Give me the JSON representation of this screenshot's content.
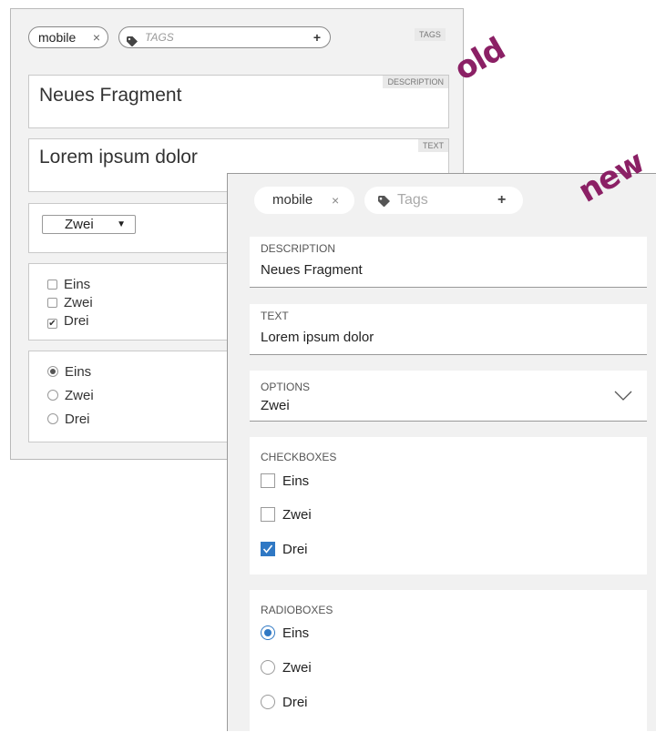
{
  "old": {
    "stamp": "old",
    "tags": {
      "chip": "mobile",
      "remove_glyph": "×",
      "placeholder": "TAGS",
      "add_glyph": "+",
      "section_label": "TAGS"
    },
    "description": {
      "label": "DESCRIPTION",
      "value": "Neues Fragment"
    },
    "text": {
      "label": "TEXT",
      "value": "Lorem ipsum dolor"
    },
    "select": {
      "value": "Zwei",
      "arrow": "▼"
    },
    "checkboxes": [
      {
        "label": "Eins",
        "checked": false
      },
      {
        "label": "Zwei",
        "checked": false
      },
      {
        "label": "Drei",
        "checked": true
      }
    ],
    "radios": [
      {
        "label": "Eins",
        "selected": true
      },
      {
        "label": "Zwei",
        "selected": false
      },
      {
        "label": "Drei",
        "selected": false
      }
    ]
  },
  "new": {
    "stamp": "new",
    "tags": {
      "chip": "mobile",
      "remove_glyph": "×",
      "placeholder": "Tags",
      "add_glyph": "+"
    },
    "description": {
      "label": "DESCRIPTION",
      "value": "Neues Fragment"
    },
    "text": {
      "label": "TEXT",
      "value": "Lorem ipsum dolor"
    },
    "options": {
      "label": "OPTIONS",
      "value": "Zwei"
    },
    "checkboxes": {
      "label": "CHECKBOXES",
      "items": [
        {
          "label": "Eins",
          "checked": false
        },
        {
          "label": "Zwei",
          "checked": false
        },
        {
          "label": "Drei",
          "checked": true
        }
      ]
    },
    "radioboxes": {
      "label": "RADIOBOXES",
      "items": [
        {
          "label": "Eins",
          "selected": true
        },
        {
          "label": "Zwei",
          "selected": false
        },
        {
          "label": "Drei",
          "selected": false
        }
      ]
    }
  },
  "colors": {
    "accent": "#2f78c4",
    "stamp": "#8b2065"
  }
}
